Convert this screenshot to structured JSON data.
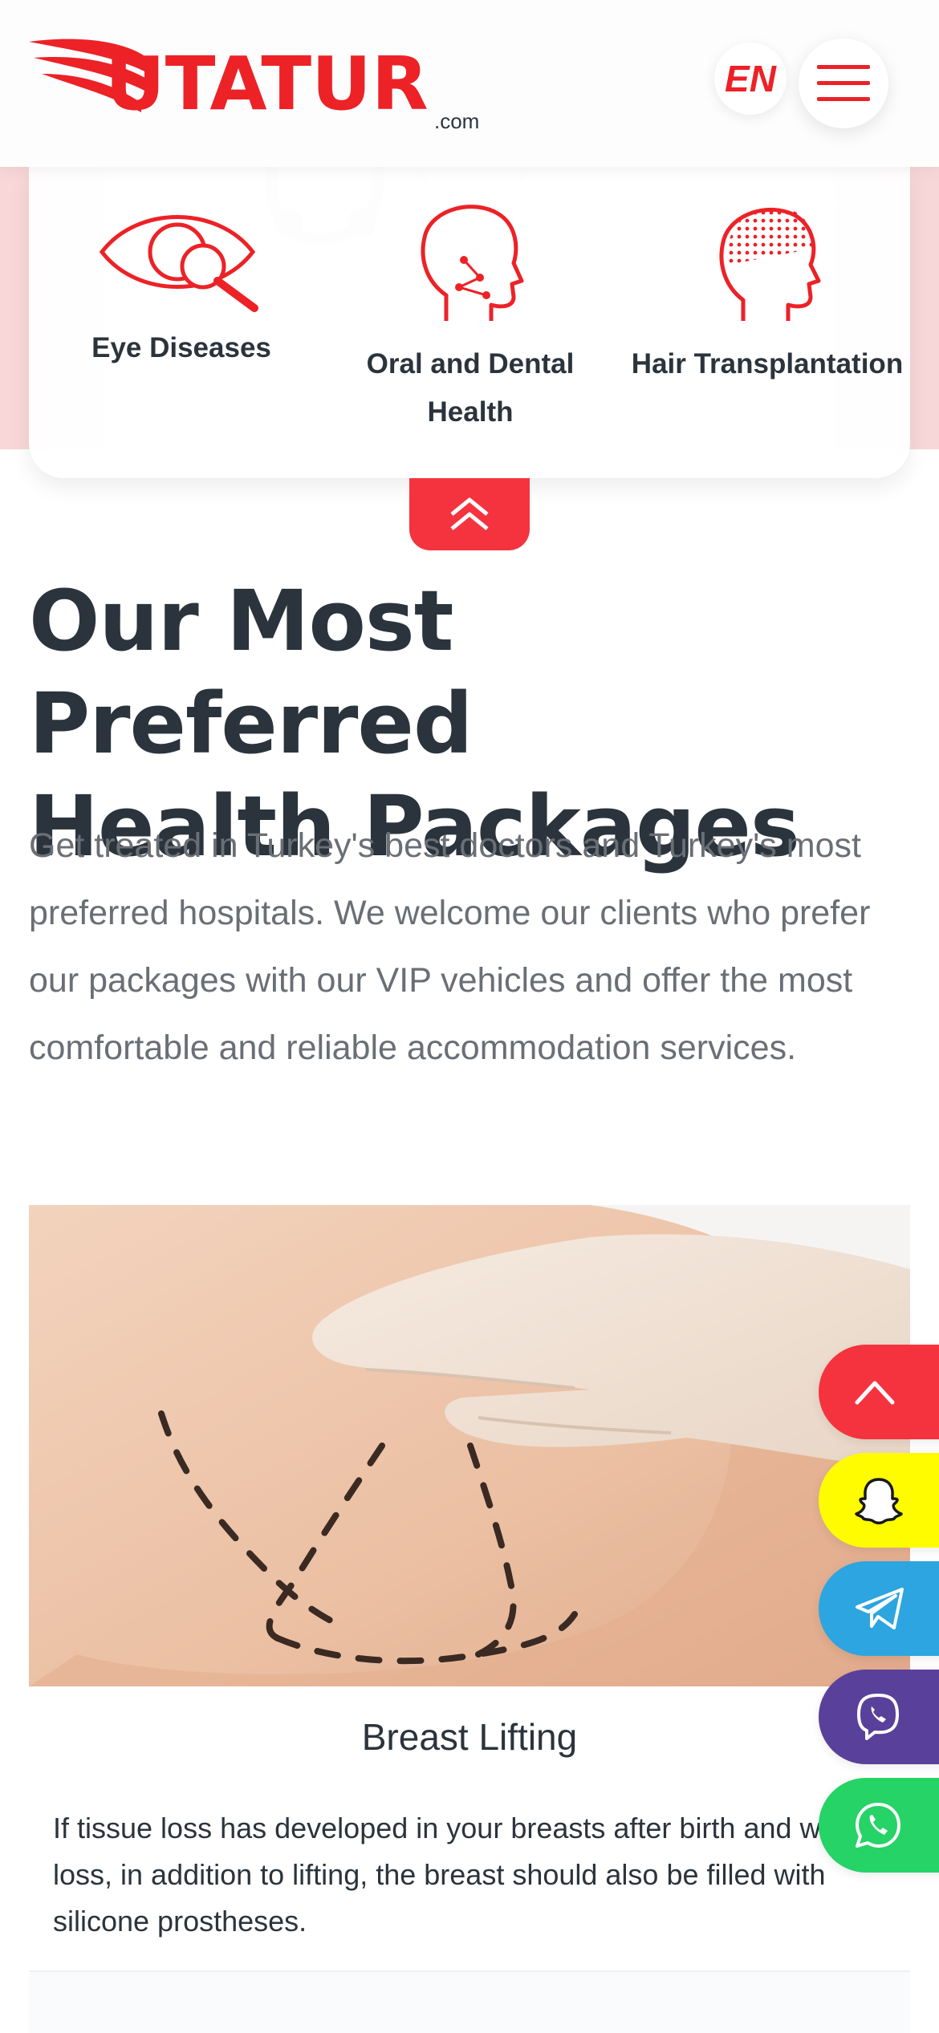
{
  "header": {
    "logo_text": "UTATUR",
    "logo_suffix": ".com",
    "language": "EN",
    "menu_icon": "hamburger-menu-icon"
  },
  "categories": [
    {
      "label": "Eye Diseases",
      "icon": "eye-magnifier-icon"
    },
    {
      "label_line1": "Oral and Dental",
      "label_line2": "Health",
      "icon": "face-dental-icon"
    },
    {
      "label": "Hair Transplantation",
      "icon": "head-hair-icon"
    }
  ],
  "collapse_icon": "double-chevron-up-icon",
  "section": {
    "title_line1": "Our Most Preferred",
    "title_line2": "Health Packages",
    "description": "Get treated in Turkey's best doctors and Turkey's most preferred hospitals. We welcome our clients who prefer our packages with our VIP vehicles and offer the most comfortable and reliable accommodation services."
  },
  "package": {
    "title": "Breast Lifting",
    "description": "If tissue loss has developed in your breasts after birth and weight loss, in addition to lifting, the breast should also be filled with silicone prostheses."
  },
  "floating_buttons": [
    {
      "name": "scroll-top",
      "icon": "chevron-up-icon",
      "color": "#f5333f"
    },
    {
      "name": "snapchat",
      "icon": "snapchat-icon",
      "color": "#fffc00"
    },
    {
      "name": "telegram",
      "icon": "telegram-icon",
      "color": "#2ca5e0"
    },
    {
      "name": "viber",
      "icon": "viber-icon",
      "color": "#59409b"
    },
    {
      "name": "whatsapp",
      "icon": "whatsapp-icon",
      "color": "#25d366"
    }
  ],
  "colors": {
    "brand_red": "#ec2227",
    "text_dark": "#2b343c",
    "text_muted": "#6a6f76"
  }
}
